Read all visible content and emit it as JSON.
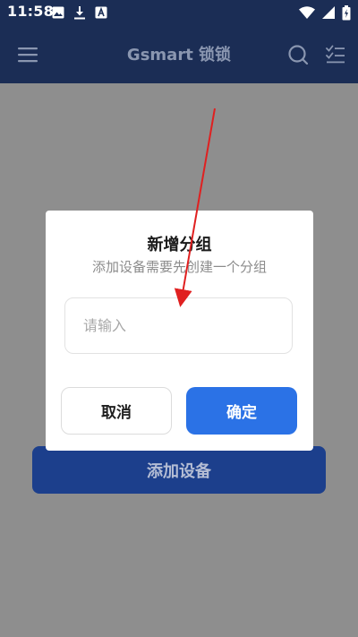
{
  "status_bar": {
    "time": "11:58",
    "left_icons": [
      "image-icon",
      "download-icon",
      "font-icon"
    ],
    "right_icons": [
      "wifi-icon",
      "signal-icon",
      "battery-icon"
    ]
  },
  "header": {
    "title": "Gsmart 锁锁",
    "menu_icon": "menu-icon",
    "search_icon": "search-icon",
    "checklist_icon": "checklist-icon"
  },
  "main": {
    "add_device_label": "添加设备"
  },
  "dialog": {
    "title": "新增分组",
    "subtitle": "添加设备需要先创建一个分组",
    "input": {
      "placeholder": "请输入",
      "value": ""
    },
    "cancel_label": "取消",
    "confirm_label": "确定"
  },
  "colors": {
    "header_bg": "#1b2d55",
    "overlay_bg": "#8e8e8e",
    "confirm_bg": "#2b72e6",
    "annotation": "#e02020"
  }
}
